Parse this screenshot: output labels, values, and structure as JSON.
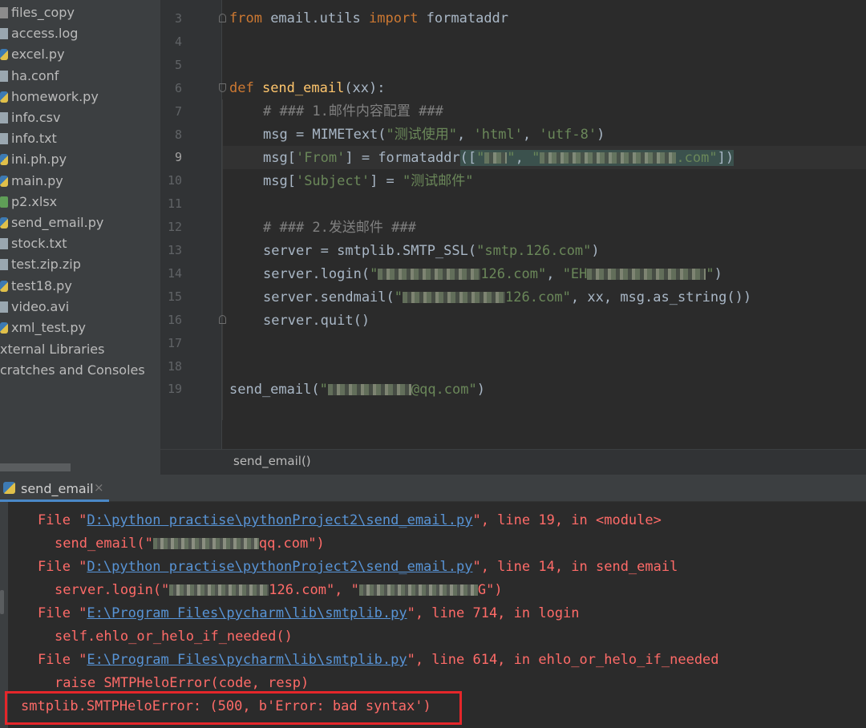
{
  "project_tree": {
    "items": [
      {
        "label": "files_copy",
        "icon": "folder-icon"
      },
      {
        "label": "access.log",
        "icon": "text-file-icon"
      },
      {
        "label": "excel.py",
        "icon": "python-file-icon"
      },
      {
        "label": "ha.conf",
        "icon": "text-file-icon"
      },
      {
        "label": "homework.py",
        "icon": "python-file-icon"
      },
      {
        "label": "info.csv",
        "icon": "text-file-icon"
      },
      {
        "label": "info.txt",
        "icon": "text-file-icon"
      },
      {
        "label": "ini.ph.py",
        "icon": "python-file-icon"
      },
      {
        "label": "main.py",
        "icon": "python-file-icon"
      },
      {
        "label": "p2.xlsx",
        "icon": "spreadsheet-icon"
      },
      {
        "label": "send_email.py",
        "icon": "python-file-icon"
      },
      {
        "label": "stock.txt",
        "icon": "text-file-icon"
      },
      {
        "label": "test.zip.zip",
        "icon": "text-file-icon"
      },
      {
        "label": "test18.py",
        "icon": "python-file-icon"
      },
      {
        "label": "video.avi",
        "icon": "text-file-icon"
      },
      {
        "label": "xml_test.py",
        "icon": "python-file-icon"
      }
    ],
    "external_libraries": "xternal Libraries",
    "scratches": "cratches and Consoles"
  },
  "editor": {
    "line_numbers": [
      "3",
      "4",
      "5",
      "6",
      "7",
      "8",
      "9",
      "10",
      "11",
      "12",
      "13",
      "14",
      "15",
      "16",
      "17",
      "18",
      "19"
    ],
    "current_line": "9",
    "code": {
      "l3_from": "from",
      "l3_mod": " email.utils ",
      "l3_import": "import",
      "l3_rest": " formataddr",
      "l6_def": "def ",
      "l6_fn": "send_email",
      "l6_rest": "(xx):",
      "l7": "# ### 1.邮件内容配置 ###",
      "l8_a": "msg = MIMEText(",
      "l8_s1": "\"测试使用\"",
      "l8_c1": ", ",
      "l8_s2": "'html'",
      "l8_c2": ", ",
      "l8_s3": "'utf-8'",
      "l8_end": ")",
      "l9_a": "msg[",
      "l9_s1": "'From'",
      "l9_b": "] = formataddr",
      "l9_p": "([",
      "l9_q1": "\"",
      "l9_q2": "\"",
      "l9_comma": ", ",
      "l9_q3": "\"",
      "l9_dom": ".com\"",
      "l9_close": "])",
      "l10_a": "msg[",
      "l10_s1": "'Subject'",
      "l10_b": "] = ",
      "l10_s2": "\"测试邮件\"",
      "l12": "# ### 2.发送邮件 ###",
      "l13_a": "server = smtplib.SMTP_SSL(",
      "l13_s": "\"smtp.126.com\"",
      "l13_end": ")",
      "l14_a": "server.login(",
      "l14_q1": "\"",
      "l14_d": "126.com\"",
      "l14_c": ", ",
      "l14_q2": "\"EH",
      "l14_q3": "\"",
      "l14_end": ")",
      "l15_a": "server.sendmail(",
      "l15_q1": "\"",
      "l15_d": "126.com\"",
      "l15_b": ", xx, msg.as_string())",
      "l16": "server.quit()",
      "l19_a": "send_email(",
      "l19_q1": "\"",
      "l19_d": "@qq.com\"",
      "l19_end": ")"
    }
  },
  "breadcrumb": {
    "label": "send_email()"
  },
  "run_panel": {
    "tab_label": "send_email",
    "close_glyph": "×",
    "lines": {
      "c1_a": "File \"",
      "c1_link": "D:\\python practise\\pythonProject2\\send_email.py",
      "c1_b": "\", line 19, in <module>",
      "c2_a": "send_email(\"",
      "c2_b": "qq.com\")",
      "c3_a": "File \"",
      "c3_link": "D:\\python practise\\pythonProject2\\send_email.py",
      "c3_b": "\", line 14, in send_email",
      "c4_a": "server.login(\"",
      "c4_b": "126.com\", \"",
      "c4_c": "G\")",
      "c5_a": "File \"",
      "c5_link": "E:\\Program Files\\pycharm\\lib\\smtplib.py",
      "c5_b": "\", line 714, in login",
      "c6": "self.ehlo_or_helo_if_needed()",
      "c7_a": "File \"",
      "c7_link": "E:\\Program Files\\pycharm\\lib\\smtplib.py",
      "c7_b": "\", line 614, in ehlo_or_helo_if_needed",
      "c8": "raise SMTPHeloError(code, resp)",
      "c9": "smtplib.SMTPHeloError: (500, b'Error: bad syntax')"
    }
  },
  "colors": {
    "error_text": "#ff6b68",
    "link": "#5894d6",
    "highlight_box": "#e5262a",
    "keyword": "#cc7832",
    "string": "#6a8759",
    "function": "#ffc66d"
  }
}
